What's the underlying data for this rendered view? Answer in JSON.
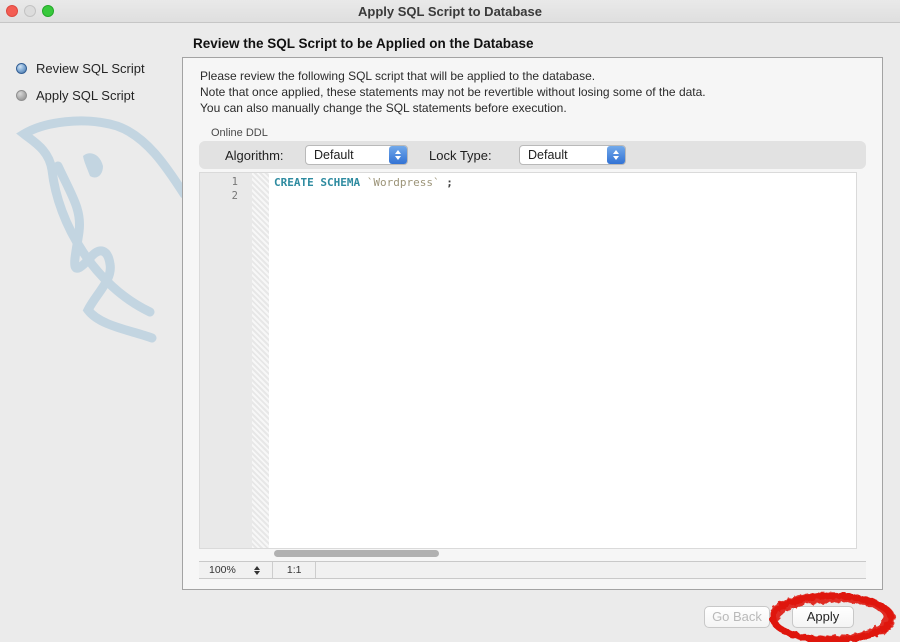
{
  "window": {
    "title": "Apply SQL Script to Database"
  },
  "traffic_lights": {
    "close_color": "#f35d53",
    "minimize_color": "#dcdcdc",
    "zoom_color": "#38c93c"
  },
  "sidebar": {
    "steps": [
      {
        "label": "Review SQL Script",
        "state": "active"
      },
      {
        "label": "Apply SQL Script",
        "state": "pending"
      }
    ]
  },
  "header": {
    "title": "Review the SQL Script to be Applied on the Database"
  },
  "instructions": {
    "line1": "Please review the following SQL script that will be applied to the database.",
    "line2": "Note that once applied, these statements may not be revertible without losing some of the data.",
    "line3": "You can also manually change the SQL statements before execution."
  },
  "online_ddl": {
    "group_label": "Online DDL",
    "algorithm_label": "Algorithm:",
    "algorithm_value": "Default",
    "lock_type_label": "Lock Type:",
    "lock_type_value": "Default"
  },
  "editor": {
    "line_numbers": [
      "1",
      "2"
    ],
    "code": {
      "keyword": "CREATE SCHEMA",
      "identifier": "`Wordpress`",
      "terminator": ";"
    },
    "colors": {
      "keyword": "#2e8ba0",
      "identifier": "#9c9478",
      "terminator": "#3f3f3f"
    }
  },
  "status_bar": {
    "zoom_level": "100%",
    "ratio": "1:1"
  },
  "footer": {
    "go_back_label": "Go Back",
    "apply_label": "Apply"
  },
  "annotation": {
    "shape": "hand-drawn-ellipse",
    "color": "#df1710",
    "target": "apply-button"
  }
}
